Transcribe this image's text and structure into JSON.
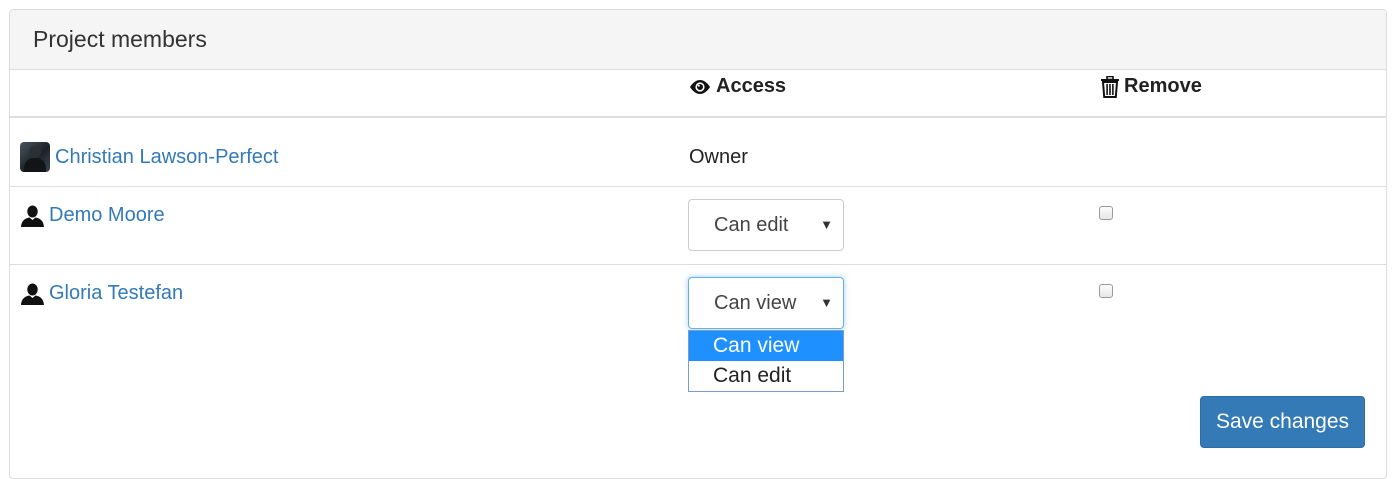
{
  "panel": {
    "title": "Project members"
  },
  "columns": {
    "access": "Access",
    "remove": "Remove",
    "access_icon": "eye-icon",
    "remove_icon": "trash-icon"
  },
  "members": [
    {
      "name": "Christian Lawson-Perfect",
      "avatar": "photo",
      "access": "Owner"
    },
    {
      "name": "Demo Moore",
      "avatar": "user-silhouette-icon",
      "access": "Can edit",
      "remove_checked": false
    },
    {
      "name": "Gloria Testefan",
      "avatar": "user-silhouette-icon",
      "access": "Can view",
      "remove_checked": false
    }
  ],
  "access_dropdown": {
    "open": true,
    "options": [
      "Can view",
      "Can edit"
    ],
    "highlighted": "Can view"
  },
  "actions": {
    "save_label": "Save changes"
  },
  "colors": {
    "link": "#337ab7",
    "primary_button": "#337ab7",
    "dropdown_highlight": "#1e90ff",
    "heading_bg": "#f5f5f5"
  }
}
